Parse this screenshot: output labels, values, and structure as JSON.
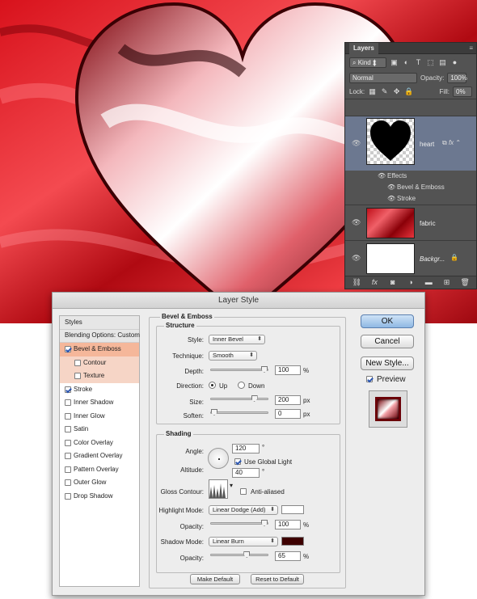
{
  "layers_panel": {
    "tab": "Layers",
    "filter_kind": "Kind",
    "blend_mode": "Normal",
    "opacity_label": "Opacity:",
    "opacity": "100%",
    "lock_label": "Lock:",
    "fill_label": "Fill:",
    "fill": "0%",
    "layers": [
      {
        "name": "heart",
        "effects_label": "Effects",
        "effects": [
          "Bevel & Emboss",
          "Stroke"
        ]
      },
      {
        "name": "fabric"
      },
      {
        "name": "Backgr..."
      }
    ]
  },
  "dialog": {
    "title": "Layer Style",
    "sidebar": {
      "header": "Styles",
      "blending": "Blending Options: Custom",
      "items": [
        {
          "label": "Bevel & Emboss",
          "checked": true
        },
        {
          "label": "Contour",
          "checked": false
        },
        {
          "label": "Texture",
          "checked": false
        },
        {
          "label": "Stroke",
          "checked": true
        },
        {
          "label": "Inner Shadow",
          "checked": false
        },
        {
          "label": "Inner Glow",
          "checked": false
        },
        {
          "label": "Satin",
          "checked": false
        },
        {
          "label": "Color Overlay",
          "checked": false
        },
        {
          "label": "Gradient Overlay",
          "checked": false
        },
        {
          "label": "Pattern Overlay",
          "checked": false
        },
        {
          "label": "Outer Glow",
          "checked": false
        },
        {
          "label": "Drop Shadow",
          "checked": false
        }
      ]
    },
    "section_title": "Bevel & Emboss",
    "structure": {
      "title": "Structure",
      "style_label": "Style:",
      "style": "Inner Bevel",
      "technique_label": "Technique:",
      "technique": "Smooth",
      "depth_label": "Depth:",
      "depth": "100",
      "depth_unit": "%",
      "depth_level": 1.0,
      "direction_label": "Direction:",
      "up": "Up",
      "down": "Down",
      "direction": "Up",
      "size_label": "Size:",
      "size": "200",
      "size_unit": "px",
      "size_level": 0.8,
      "soften_label": "Soften:",
      "soften": "0",
      "soften_unit": "px",
      "soften_level": 0.0
    },
    "shading": {
      "title": "Shading",
      "angle_label": "Angle:",
      "angle": "120",
      "degree": "°",
      "global_light": "Use Global Light",
      "altitude_label": "Altitude:",
      "altitude": "40",
      "gloss_label": "Gloss Contour:",
      "anti_aliased": "Anti-aliased",
      "highlight_label": "Highlight Mode:",
      "highlight_mode": "Linear Dodge (Add)",
      "highlight_color": "#ffffff",
      "hl_opacity_label": "Opacity:",
      "hl_opacity": "100",
      "hl_opacity_level": 1.0,
      "shadow_label": "Shadow Mode:",
      "shadow_mode": "Linear Burn",
      "shadow_color": "#3d0000",
      "sh_opacity_label": "Opacity:",
      "sh_opacity": "65",
      "sh_opacity_level": 0.65,
      "pct": "%"
    },
    "make_default": "Make Default",
    "reset_default": "Reset to Default",
    "ok": "OK",
    "cancel": "Cancel",
    "new_style": "New Style...",
    "preview": "Preview"
  }
}
